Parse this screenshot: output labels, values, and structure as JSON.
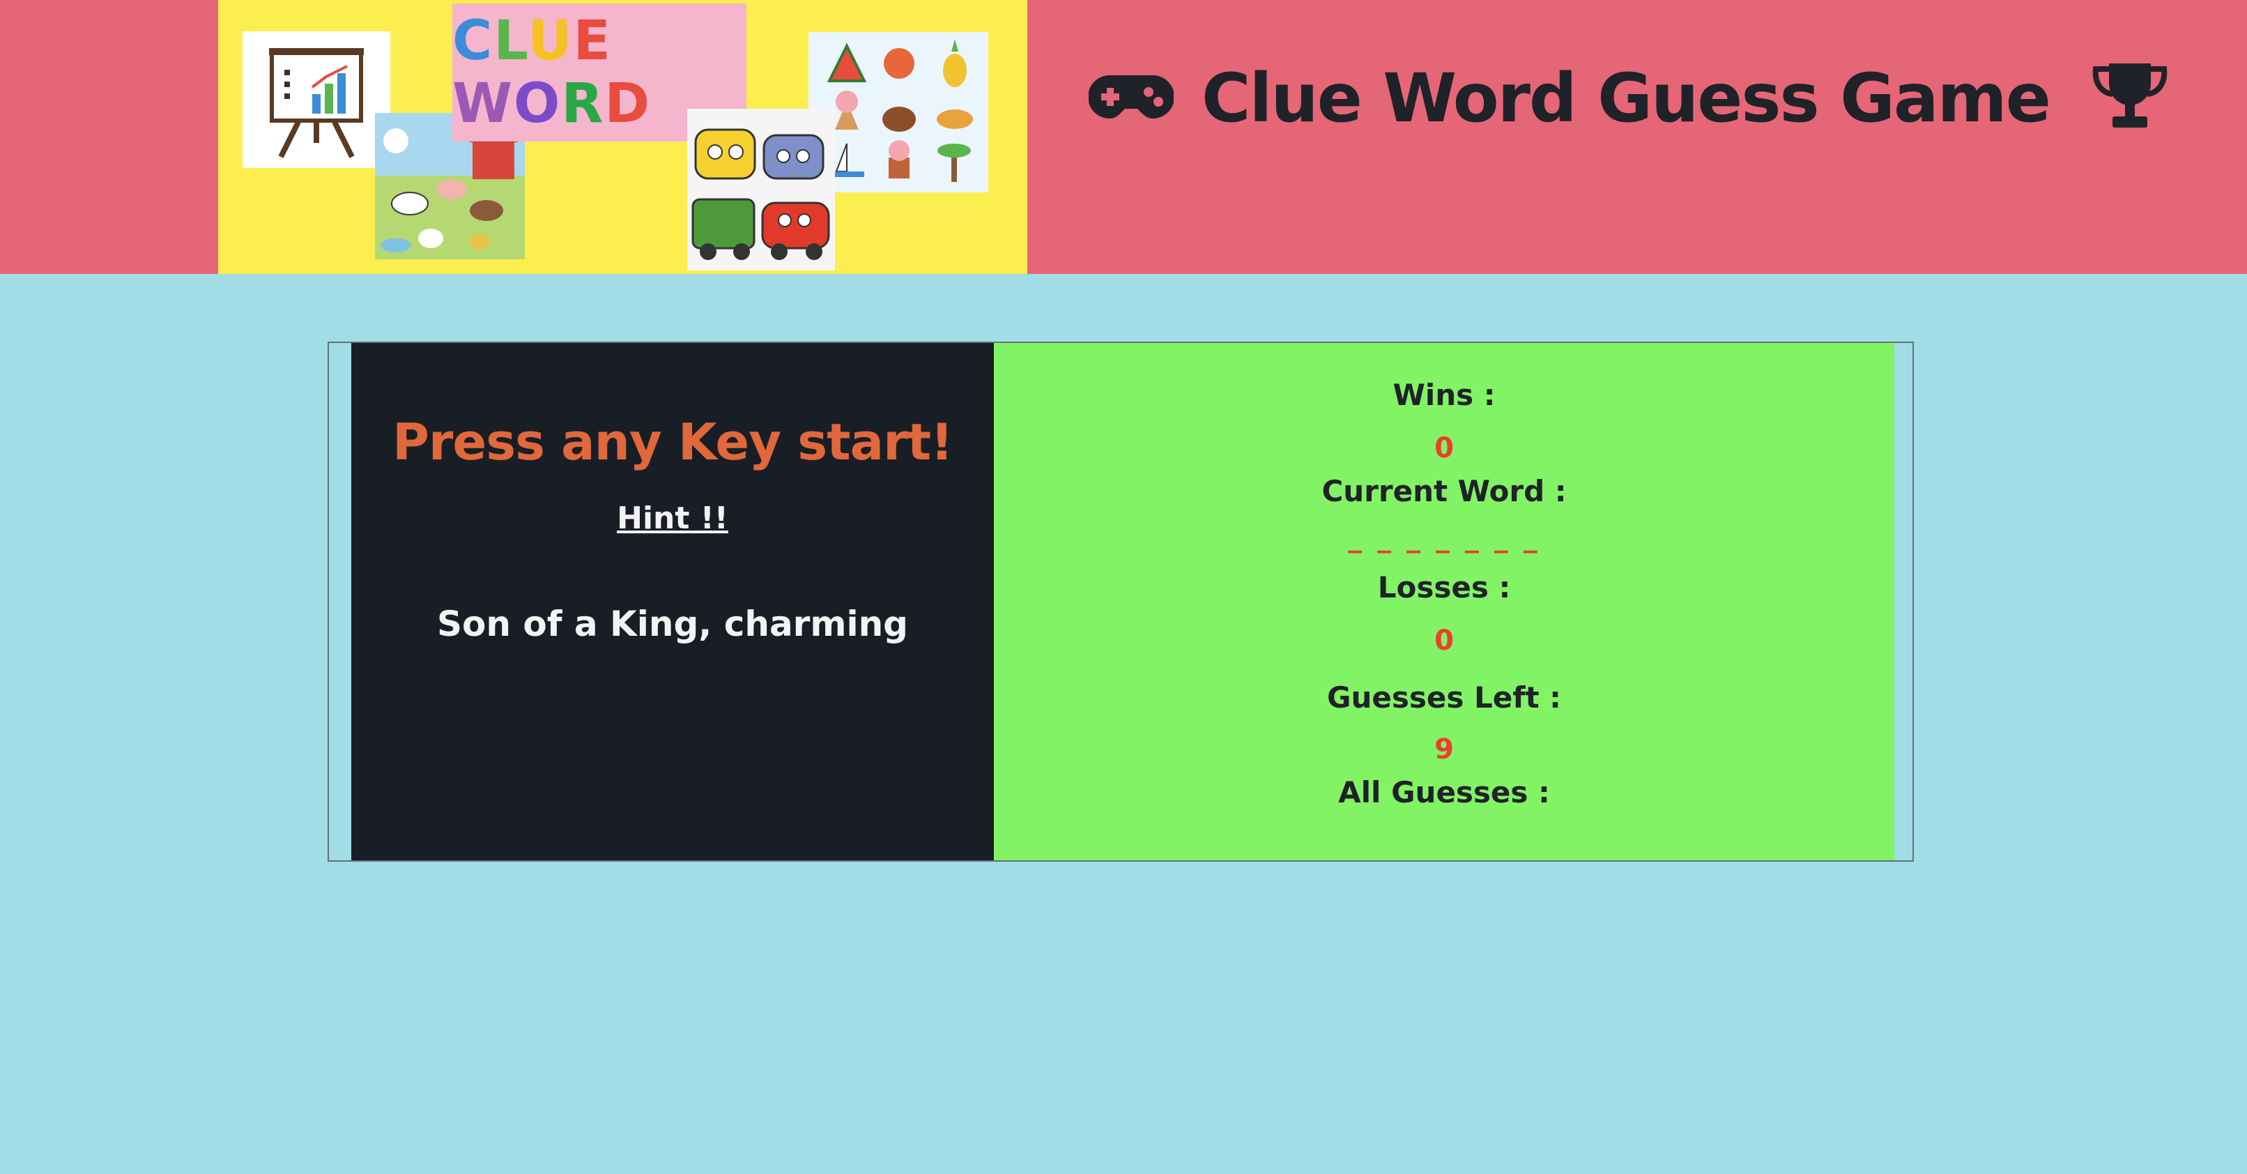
{
  "header": {
    "banner_logo_text": "CLUE WORD",
    "banner_logo_colors": [
      "#3b8dd8",
      "#59b64a",
      "#f5c221",
      "#e84c3d",
      "#9b59b6",
      "#7c4bc9",
      "#28a745",
      "#e74c3c",
      "#1a3ec9"
    ],
    "title": "Clue Word Guess Game",
    "left_icon": "gamepad-icon",
    "right_icon": "trophy-icon"
  },
  "game": {
    "prompt": "Press any Key start!",
    "hint_label": "Hint !!",
    "hint_text": "Son of a King, charming"
  },
  "stats": {
    "wins_label": "Wins :",
    "wins_value": "0",
    "current_word_label": "Current Word :",
    "current_word_value": "_ _ _ _ _ _ _",
    "losses_label": "Losses :",
    "losses_value": "0",
    "guesses_left_label": "Guesses Left :",
    "guesses_left_value": "9",
    "all_guesses_label": "All Guesses :",
    "all_guesses_value": ""
  },
  "colors": {
    "header_bg": "#e56677",
    "banner_bg": "#fdee4f",
    "page_bg": "#a0dde6",
    "left_panel_bg": "#191e26",
    "right_panel_bg": "#82f365",
    "prompt_color": "#e0683a",
    "value_color": "#ee3d2a"
  }
}
